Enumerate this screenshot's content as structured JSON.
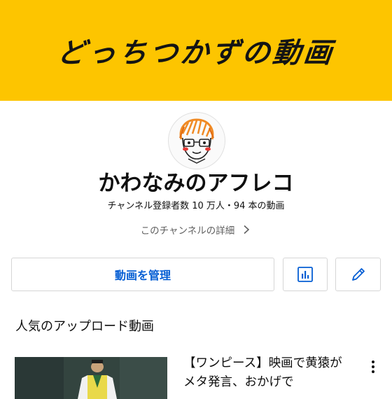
{
  "banner": {
    "text": "どっちつかずの動画"
  },
  "channel": {
    "name": "かわなみのアフレコ",
    "meta": "チャンネル登録者数 10 万人・94 本の動画",
    "details_link": "このチャンネルの詳細"
  },
  "actions": {
    "manage_label": "動画を管理",
    "analytics_icon": "bar-chart-icon",
    "edit_icon": "pencil-icon"
  },
  "popular": {
    "section_title": "人気のアップロード動画",
    "videos": [
      {
        "title": "【ワンピース】映画で黄猿がメタ発言、おかげで"
      }
    ]
  },
  "colors": {
    "banner_bg": "#fdc500",
    "accent": "#065fd4",
    "secondary_text": "#606060"
  }
}
